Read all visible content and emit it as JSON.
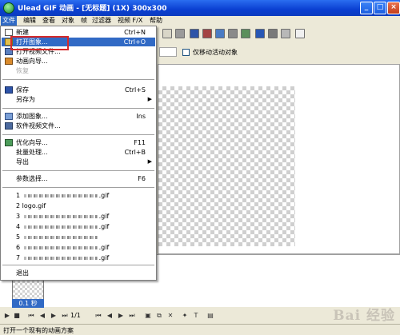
{
  "window": {
    "title": "Ulead GIF 动画 - [无标题] (1X) 300x300",
    "controls": [
      "_",
      "□",
      "×"
    ]
  },
  "menubar": [
    "文件",
    "编辑",
    "查看",
    "对象",
    "帧",
    "过滤器",
    "视频 F/X",
    "帮助"
  ],
  "file_menu": {
    "items": [
      {
        "label": "新建",
        "shortcut": "Ctrl+N",
        "icon": "new-document-icon"
      },
      {
        "label": "打开图象...",
        "shortcut": "Ctrl+O",
        "icon": "open-folder-icon"
      },
      {
        "label": "打开视频文件...",
        "shortcut": "",
        "icon": "open-video-icon"
      },
      {
        "label": "动画向导...",
        "shortcut": "",
        "icon": "wizard-icon"
      },
      {
        "label": "恢复",
        "shortcut": ""
      },
      {
        "label": "保存",
        "shortcut": "Ctrl+S",
        "icon": "save-icon"
      },
      {
        "label": "另存为",
        "shortcut": ""
      },
      {
        "label": "添加图象...",
        "shortcut": "Ins",
        "icon": "add-image-icon"
      },
      {
        "label": "软件视频文件...",
        "shortcut": "",
        "icon": "add-video-icon"
      },
      {
        "label": "优化向导...",
        "shortcut": "F11",
        "icon": "optimize-icon"
      },
      {
        "label": "批量处理...",
        "shortcut": "Ctrl+B"
      },
      {
        "label": "导出",
        "shortcut": ""
      },
      {
        "label": "参数选择...",
        "shortcut": "F6"
      }
    ],
    "recent": [
      {
        "num": "1",
        "prefix": "",
        "suffix": ".gif"
      },
      {
        "num": "2",
        "prefix": "logo.gif",
        "suffix": ""
      },
      {
        "num": "3",
        "prefix": "",
        "suffix": ".gif"
      },
      {
        "num": "4",
        "prefix": "",
        "suffix": ".gif"
      },
      {
        "num": "5",
        "prefix": "",
        "suffix": ""
      },
      {
        "num": "6",
        "prefix": "",
        "suffix": ".gif"
      },
      {
        "num": "7",
        "prefix": "",
        "suffix": ".gif"
      }
    ],
    "exit": "退出"
  },
  "toolbar2": {
    "only_moving_label": "仅移动活动对象"
  },
  "frame": {
    "delay": "0.1 秒"
  },
  "playbar": {
    "counter": "1/1"
  },
  "status": "打开一个现有的动画方案",
  "watermark": "Bai 经验",
  "colors": {
    "title_blue": "#0a3fd1",
    "highlight": "#316ac5",
    "annotation_red": "#d62a2a"
  }
}
